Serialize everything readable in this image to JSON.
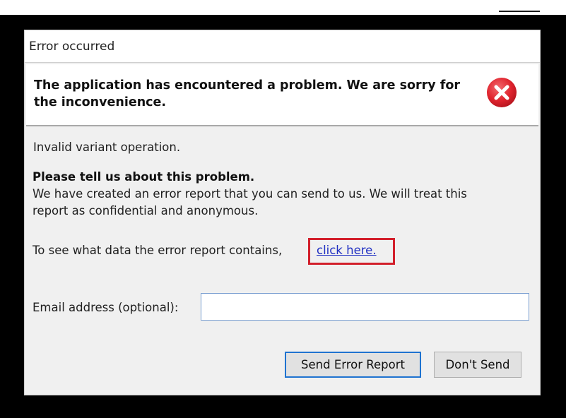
{
  "dialog": {
    "title": "Error occurred",
    "header_text": "The application has encountered a problem. We are sorry for the inconvenience.",
    "error_icon": "error-circle-x-icon",
    "error_message": "Invalid variant operation.",
    "tell_heading": "Please tell us about this problem.",
    "report_line_1": "We have created an error report that you can send to us. We will treat this",
    "report_line_2": "report as confidential and anonymous.",
    "see_data_text": "To see what data the error report contains,",
    "link_text": "click here.",
    "email_label": "Email address (optional):",
    "email_value": "",
    "send_button": "Send Error Report",
    "dont_send_button": "Don't Send"
  },
  "colors": {
    "error_red": "#e0242e",
    "link_blue": "#1f2fc2",
    "highlight_box": "#d21f2b",
    "primary_button_border": "#1f73d0"
  }
}
